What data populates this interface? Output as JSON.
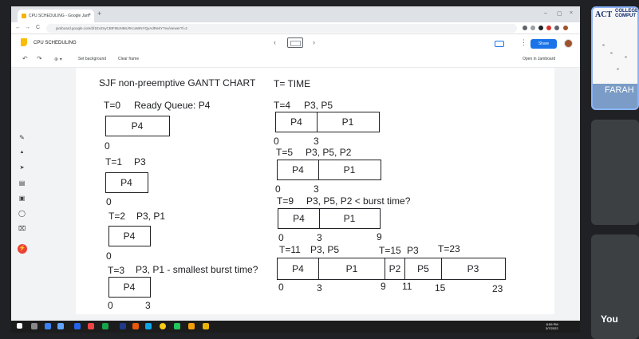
{
  "browser": {
    "tab_title": "CPU SCHEDULING - Google Jam",
    "tab_close": "×",
    "new_tab": "+",
    "win_min": "–",
    "win_max": "▢",
    "win_close": "×",
    "url": "jamboard.google.com/d/1EvZnyCBtFIBoNMLRKcaWNYQyAdRe6Y7eu/viewer?f=2",
    "nav_back": "←",
    "nav_forward": "→",
    "nav_reload": "C"
  },
  "jamboard": {
    "title": "CPU SCHEDULING",
    "prev_frame": "‹",
    "next_frame": "›",
    "more": "⋮",
    "share_label": "Share",
    "undo": "↶",
    "redo": "↷",
    "zoom": "⊕ ▾",
    "set_background": "Set background",
    "clear_frame": "Clear frame",
    "open_in_jamboard": "Open in Jamboard"
  },
  "board": {
    "heading": "SJF non-preemptive GANTT CHART",
    "legend": "T= TIME",
    "left_column": [
      {
        "time": "T=0",
        "note": "Ready Queue: P4",
        "cells": [
          "P4"
        ],
        "ticks": [
          "0"
        ]
      },
      {
        "time": "T=1",
        "note": "P3",
        "cells": [
          "P4"
        ],
        "ticks": [
          "0"
        ]
      },
      {
        "time": "T=2",
        "note": "P3, P1",
        "cells": [
          "P4"
        ],
        "ticks": [
          "0"
        ]
      },
      {
        "time": "T=3",
        "note": "P3, P1 - smallest burst time?",
        "cells": [
          "P4"
        ],
        "ticks": [
          "0",
          "3"
        ]
      }
    ],
    "right_column": [
      {
        "time": "T=4",
        "note": "P3, P5",
        "cells": [
          "P4",
          "P1"
        ],
        "ticks": [
          "0",
          "3"
        ]
      },
      {
        "time": "T=5",
        "note": "P3, P5, P2",
        "cells": [
          "P4",
          "P1"
        ],
        "ticks": [
          "0",
          "3"
        ]
      },
      {
        "time": "T=9",
        "note": "P3, P5, P2 < burst time?",
        "cells": [
          "P4",
          "P1"
        ],
        "ticks": [
          "0",
          "3",
          "9"
        ]
      }
    ],
    "final": {
      "time_a": "T=11",
      "note_a": "P3, P5",
      "time_b": "T=15",
      "note_b": "P3",
      "time_c": "T=23",
      "cells": [
        "P4",
        "P1",
        "P2",
        "P5",
        "P3"
      ],
      "ticks": [
        "0",
        "3",
        "9",
        "11",
        "15",
        "23"
      ]
    }
  },
  "left_tools": [
    "✎",
    "▲",
    "➤",
    "▤",
    "▣",
    "◯",
    "⌧",
    "⚡"
  ],
  "taskbar": {
    "clock_time": "8:59 PM",
    "clock_date": "3/7/2022"
  },
  "participants": {
    "tile1_logo": "ACT",
    "tile1_college": "COLLEGE",
    "tile1_computer": "COMPUT",
    "tile1_name": "FARAH",
    "you_label": "You"
  },
  "colors": {
    "share_blue": "#1a73e8",
    "jam_yellow": "#fbbc04",
    "laser_red": "#ea4335"
  }
}
